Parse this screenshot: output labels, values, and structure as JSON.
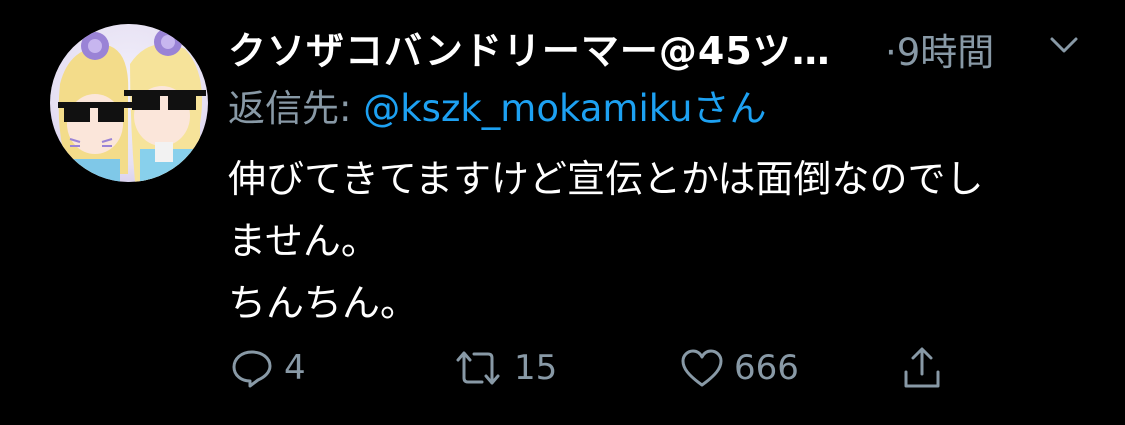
{
  "tweet": {
    "display_name": "クソザコバンドリーマー@45ツ…",
    "time": "·9時間",
    "reply_prefix": "返信先: ",
    "reply_handle": "@kszk_mokamikuさん",
    "body_lines": [
      "伸びてきてますけど宣伝とかは面倒なのでし",
      "ません。",
      "ちんちん。"
    ],
    "actions": {
      "reply_count": "4",
      "retweet_count": "15",
      "like_count": "666"
    },
    "colors": {
      "background": "#000000",
      "muted": "#8899a6",
      "link": "#1da1f2",
      "text": "#ffffff"
    },
    "icons": {
      "caret": "chevron-down-icon",
      "reply": "speech-bubble-icon",
      "retweet": "retweet-arrows-icon",
      "like": "heart-icon",
      "share": "share-upload-icon"
    }
  }
}
